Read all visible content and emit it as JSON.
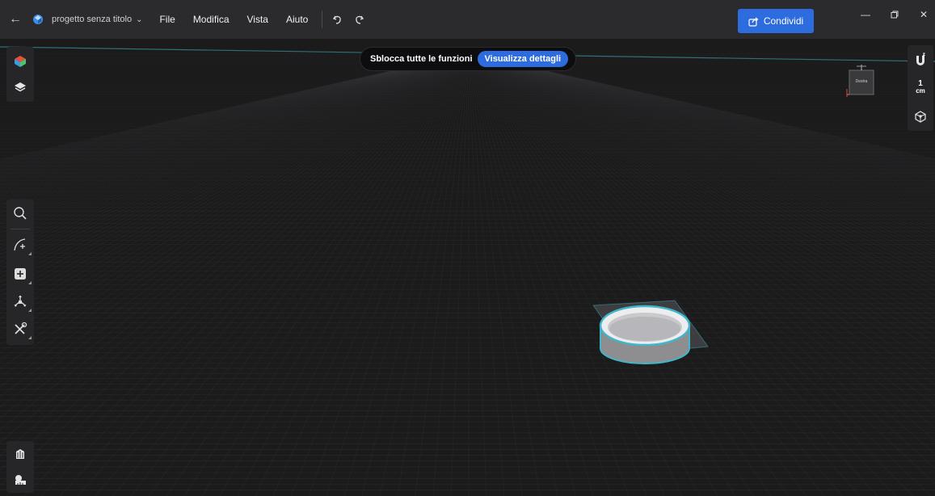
{
  "titlebar": {
    "project_name": "progetto senza titolo",
    "menus": [
      "File",
      "Modifica",
      "Vista",
      "Aiuto"
    ],
    "share_label": "Condividi"
  },
  "banner": {
    "text": "Sblocca tutte le funzioni",
    "button_label": "Visualizza dettagli"
  },
  "view_cube": {
    "face_label": "Destra"
  },
  "right_toolbar": {
    "unit_value": "1",
    "unit_label": "cm"
  },
  "icons": {
    "back": "back-arrow-icon",
    "logo": "app-logo-icon",
    "undo": "undo-icon",
    "redo": "redo-icon",
    "share": "share-icon",
    "left_tools": [
      "objects-icon",
      "layers-icon",
      "search-icon",
      "sketch-icon",
      "add-primitive-icon",
      "transform-icon",
      "tools-icon",
      "materials-icon",
      "measure-icon"
    ],
    "right_tools": [
      "snap-magnet-icon",
      "units-icon",
      "view-mode-icon"
    ]
  },
  "colors": {
    "accent": "#2d6cdf",
    "titlebar": "#2b2b2d",
    "canvas": "#1b1b1c",
    "selection": "#3fb6c9"
  }
}
